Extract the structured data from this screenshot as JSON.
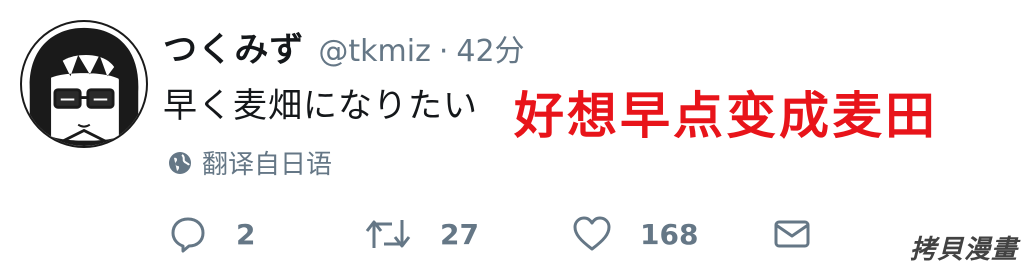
{
  "author": {
    "display_name": "つくみず",
    "handle": "@tkmiz",
    "separator": "·",
    "timestamp": "42分"
  },
  "tweet": {
    "text": "早く麦畑になりたい"
  },
  "overlay": {
    "caption": "好想早点变成麦田",
    "color": "#e8141a"
  },
  "translate": {
    "label": "翻译自日语",
    "icon": "globe-icon"
  },
  "actions": {
    "reply": {
      "icon": "reply-icon",
      "count": "2"
    },
    "retweet": {
      "icon": "retweet-icon",
      "count": "27"
    },
    "like": {
      "icon": "heart-icon",
      "count": "168"
    },
    "dm": {
      "icon": "envelope-icon"
    }
  },
  "watermark": {
    "text": "拷貝漫畫"
  },
  "colors": {
    "text_primary": "#14171a",
    "text_secondary": "#657786",
    "background": "#ffffff"
  }
}
